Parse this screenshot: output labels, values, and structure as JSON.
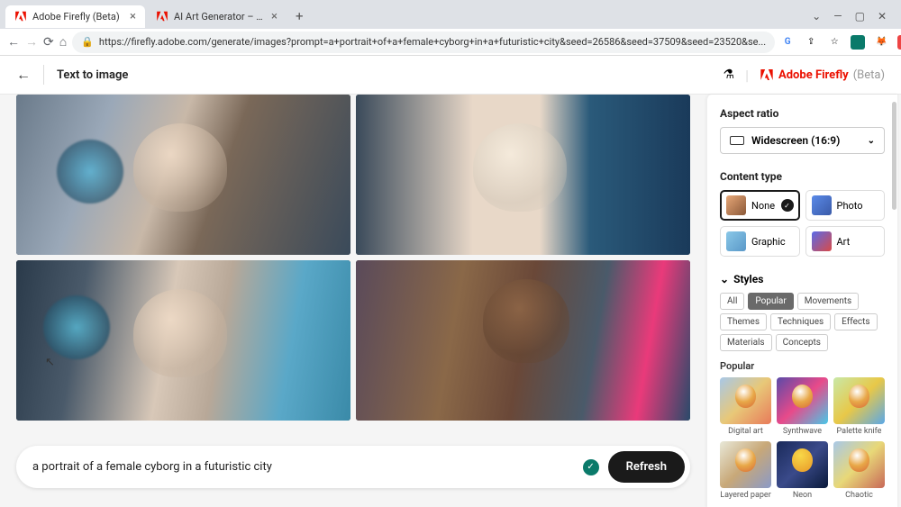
{
  "browser": {
    "tabs": [
      {
        "title": "Adobe Firefly (Beta)"
      },
      {
        "title": "AI Art Generator – Adobe Firefly"
      }
    ],
    "url": "https://firefly.adobe.com/generate/images?prompt=a+portrait+of+a+female+cyborg+in+a+futuristic+city&seed=26586&seed=37509&seed=23520&se..."
  },
  "header": {
    "page_title": "Text to image",
    "brand_name": "Adobe Firefly",
    "brand_suffix": "(Beta)"
  },
  "prompt": {
    "text": "a portrait of a female cyborg in a futuristic city",
    "refresh_label": "Refresh"
  },
  "panel": {
    "aspect_ratio": {
      "label": "Aspect ratio",
      "value": "Widescreen (16:9)"
    },
    "content_type": {
      "label": "Content type",
      "items": [
        {
          "name": "None",
          "selected": true
        },
        {
          "name": "Photo",
          "selected": false
        },
        {
          "name": "Graphic",
          "selected": false
        },
        {
          "name": "Art",
          "selected": false
        }
      ]
    },
    "styles": {
      "label": "Styles",
      "tabs": [
        "All",
        "Popular",
        "Movements",
        "Themes",
        "Techniques",
        "Effects",
        "Materials",
        "Concepts"
      ],
      "active_tab": "Popular",
      "section_label": "Popular",
      "items": [
        "Digital art",
        "Synthwave",
        "Palette knife",
        "Layered paper",
        "Neon",
        "Chaotic"
      ]
    }
  }
}
